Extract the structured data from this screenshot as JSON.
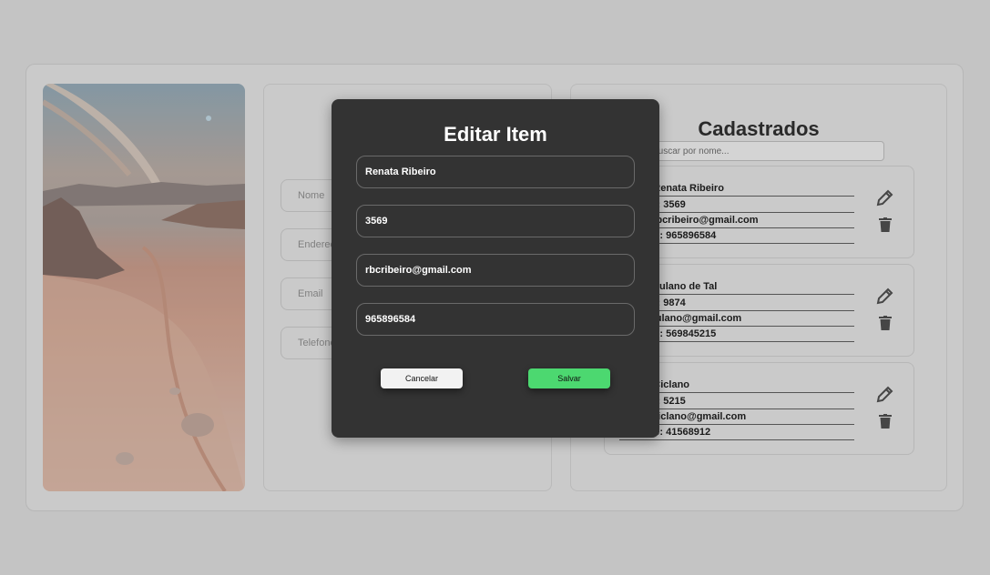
{
  "form": {
    "fields": [
      {
        "placeholder": "Nome"
      },
      {
        "placeholder": "Endereço"
      },
      {
        "placeholder": "Email"
      },
      {
        "placeholder": "Telefone"
      }
    ]
  },
  "list": {
    "title": "Cadastrados",
    "search_placeholder": "Buscar por nome...",
    "items": [
      {
        "nome": "Nome: Renata Ribeiro",
        "numero": "Número: 3569",
        "email": "Email: rbcribeiro@gmail.com",
        "telefone": "Telefone: 965896584"
      },
      {
        "nome": "Nome: Fulano de Tal",
        "numero": "Número: 9874",
        "email": "Email: fulano@gmail.com",
        "telefone": "Telefone: 569845215"
      },
      {
        "nome": "Nome: Ciclano",
        "numero": "Número: 5215",
        "email": "Email: ciclano@gmail.com",
        "telefone": "Telefone: 41568912"
      }
    ],
    "edit_icon": "pencil-icon",
    "delete_icon": "trash-icon"
  },
  "modal": {
    "title": "Editar Item",
    "fields": {
      "nome": "Renata Ribeiro",
      "numero": "3569",
      "email": "rbcribeiro@gmail.com",
      "telefone": "965896584"
    },
    "cancel_label": "Cancelar",
    "save_label": "Salvar"
  },
  "colors": {
    "modal_bg": "#333333",
    "save_button": "#4cd870",
    "overlay": "rgba(0,0,0,0.17)"
  }
}
